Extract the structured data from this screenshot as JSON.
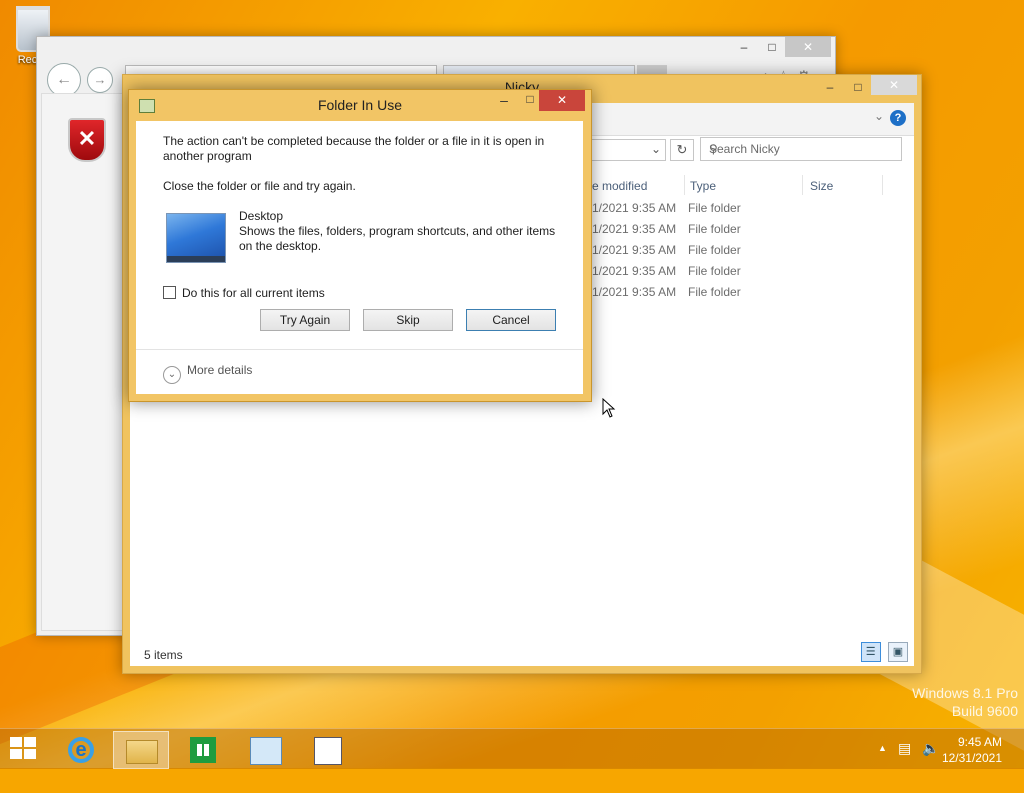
{
  "desktop": {
    "recycle_bin_label": "Recyc",
    "watermark_line1": "Windows 8.1 Pro",
    "watermark_line2": "Build 9600"
  },
  "ie_window": {
    "min_label": "–",
    "max_label": "□",
    "close_label": "✕"
  },
  "explorer": {
    "title": "Nicky",
    "min_label": "–",
    "max_label": "□",
    "close_label": "✕",
    "help_label": "?",
    "search_placeholder": "Search Nicky",
    "columns": {
      "date": "e modified",
      "type": "Type",
      "size": "Size"
    },
    "rows": [
      {
        "date": "1/2021 9:35 AM",
        "type": "File folder"
      },
      {
        "date": "1/2021 9:35 AM",
        "type": "File folder"
      },
      {
        "date": "1/2021 9:35 AM",
        "type": "File folder"
      },
      {
        "date": "1/2021 9:35 AM",
        "type": "File folder"
      },
      {
        "date": "1/2021 9:35 AM",
        "type": "File folder"
      }
    ],
    "status": "5 items"
  },
  "dialog": {
    "title": "Folder In Use",
    "min_label": "–",
    "max_label": "□",
    "close_label": "✕",
    "message": "The action can't be completed because the folder or a file in it is open in another program",
    "instruction": "Close the folder or file and try again.",
    "item_name": "Desktop",
    "item_description": "Shows the files, folders, program shortcuts, and other items on the desktop.",
    "checkbox_label": "Do this for all current items",
    "checkbox_checked": false,
    "buttons": {
      "try_again": "Try Again",
      "skip": "Skip",
      "cancel": "Cancel"
    },
    "more_details": "More details"
  },
  "taskbar": {
    "pinned": [
      "internet-explorer-icon",
      "file-explorer-icon",
      "store-icon",
      "network-icon",
      "document-icon"
    ],
    "active": "file-explorer-icon",
    "time": "9:45 AM",
    "date": "12/31/2021"
  },
  "colors": {
    "desktop_accent": "#f7a600",
    "window_frame": "#f2c565",
    "close_button": "#c9453b",
    "help_blue": "#1d6fc7"
  }
}
